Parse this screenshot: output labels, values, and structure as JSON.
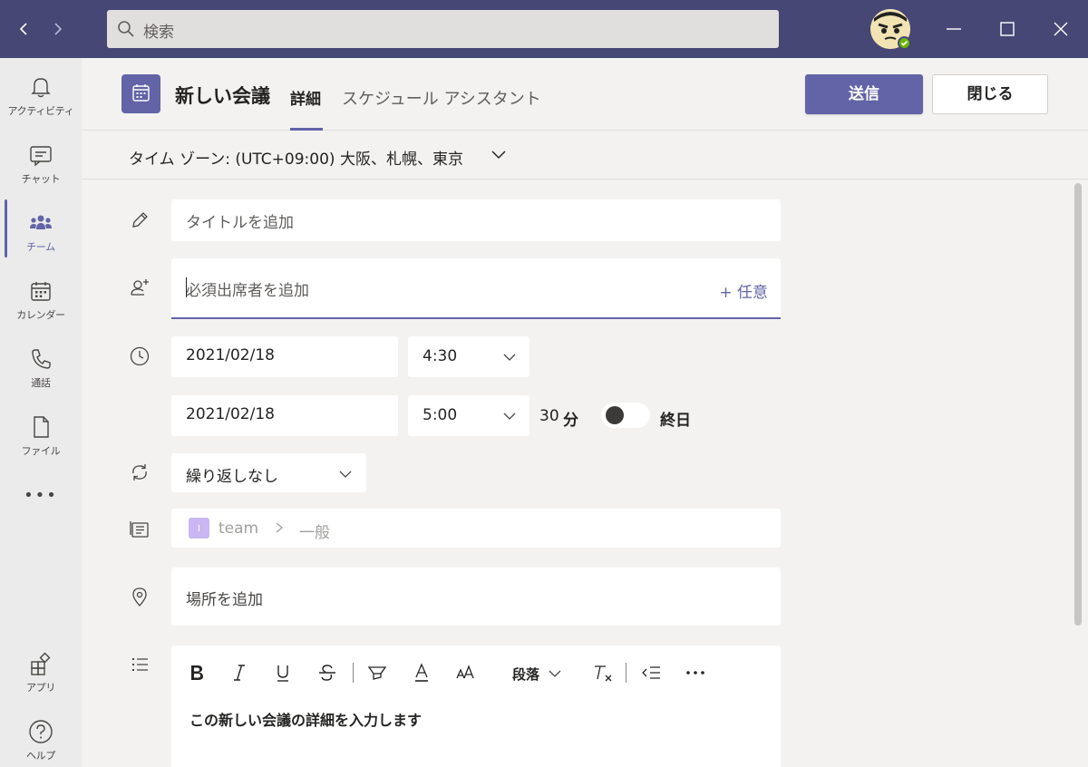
{
  "search": {
    "placeholder": "検索"
  },
  "rail": {
    "items": [
      {
        "label": "アクティビティ",
        "icon": "bell-icon"
      },
      {
        "label": "チャット",
        "icon": "chat-icon"
      },
      {
        "label": "チーム",
        "icon": "teams-icon"
      },
      {
        "label": "カレンダー",
        "icon": "calendar-icon"
      },
      {
        "label": "通話",
        "icon": "phone-icon"
      },
      {
        "label": "ファイル",
        "icon": "file-icon"
      },
      {
        "label": "アプリ",
        "icon": "apps-icon"
      },
      {
        "label": "ヘルプ",
        "icon": "help-icon"
      }
    ],
    "more": "•••"
  },
  "header": {
    "title": "新しい会議",
    "tab_details": "詳細",
    "tab_schedule": "スケジュール アシスタント",
    "send_label": "送信",
    "close_label": "閉じる"
  },
  "timezone": {
    "label": "タイム ゾーン: (UTC+09:00) 大阪、札幌、東京"
  },
  "form": {
    "title_placeholder": "タイトルを追加",
    "attendees_placeholder": "必須出席者を追加",
    "optional_label": "+ 任意",
    "start_date": "2021/02/18",
    "start_time": "4:30",
    "end_date": "2021/02/18",
    "end_time": "5:00",
    "duration_num": "30",
    "duration_unit": "分",
    "all_day_label": "終日",
    "all_day_on": false,
    "repeat_value": "繰り返しなし",
    "channel_team": "team",
    "channel_name": "一般",
    "location_placeholder": "場所を追加",
    "details_placeholder": "この新しい会議の詳細を入力します"
  },
  "toolbar": {
    "paragraph_label": "段落"
  },
  "colors": {
    "accent": "#6264a7",
    "titlebar": "#464775",
    "presence": "#6bb700"
  }
}
